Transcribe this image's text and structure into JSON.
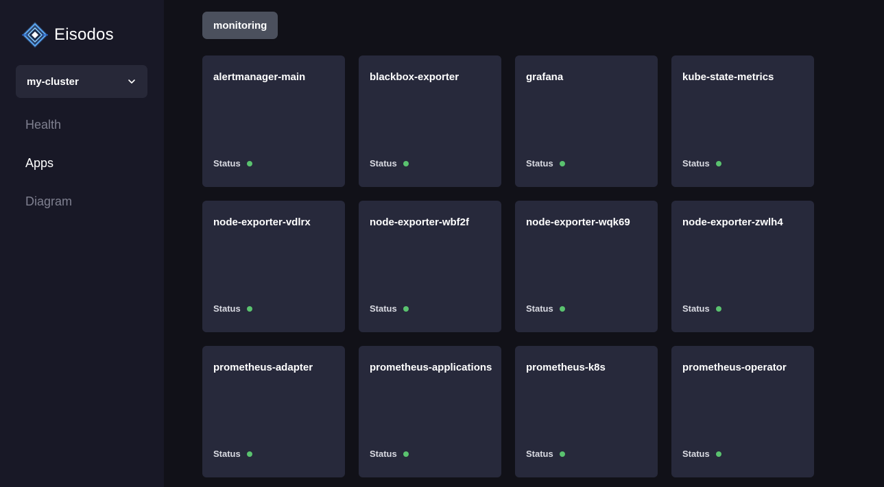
{
  "brand": {
    "name": "Eisodos",
    "logo_icon": "eisodos-diamond-logo-icon"
  },
  "cluster_selector": {
    "value": "my-cluster",
    "icon": "chevron-down-icon"
  },
  "nav": {
    "items": [
      {
        "label": "Health",
        "active": false
      },
      {
        "label": "Apps",
        "active": true
      },
      {
        "label": "Diagram",
        "active": false
      }
    ]
  },
  "filter": {
    "namespace": "monitoring"
  },
  "status_label": "Status",
  "colors": {
    "status_ok": "#5ac26f",
    "card_bg": "#27293b",
    "sidebar_bg": "#181826",
    "page_bg": "#111118"
  },
  "apps": [
    {
      "name": "alertmanager-main",
      "status": "healthy"
    },
    {
      "name": "blackbox-exporter",
      "status": "healthy"
    },
    {
      "name": "grafana",
      "status": "healthy"
    },
    {
      "name": "kube-state-metrics",
      "status": "healthy"
    },
    {
      "name": "node-exporter-vdlrx",
      "status": "healthy"
    },
    {
      "name": "node-exporter-wbf2f",
      "status": "healthy"
    },
    {
      "name": "node-exporter-wqk69",
      "status": "healthy"
    },
    {
      "name": "node-exporter-zwlh4",
      "status": "healthy"
    },
    {
      "name": "prometheus-adapter",
      "status": "healthy"
    },
    {
      "name": "prometheus-applications",
      "status": "healthy"
    },
    {
      "name": "prometheus-k8s",
      "status": "healthy"
    },
    {
      "name": "prometheus-operator",
      "status": "healthy"
    }
  ]
}
